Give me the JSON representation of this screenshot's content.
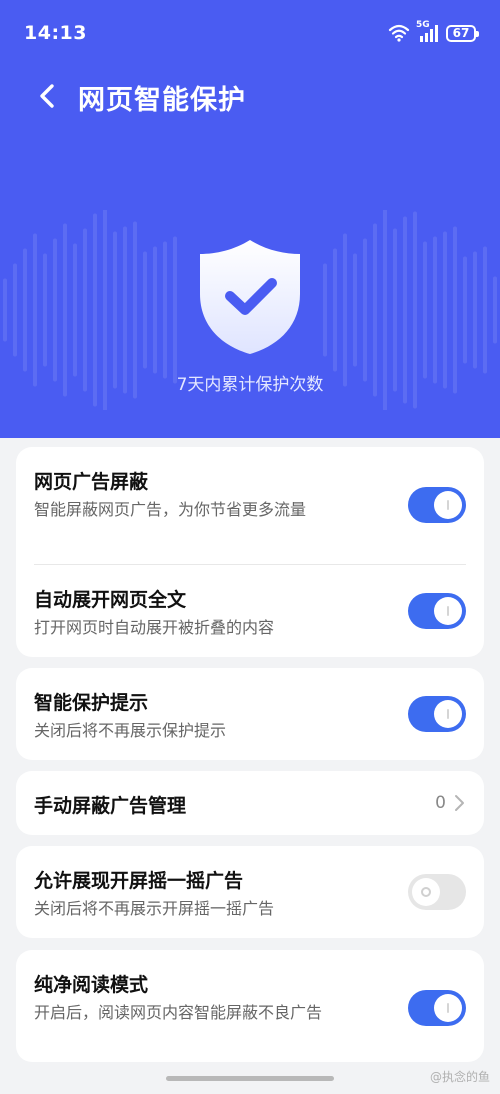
{
  "status": {
    "time": "14:13",
    "network": "5G",
    "battery": "67",
    "icons": [
      "wifi-icon",
      "signal-icon",
      "battery-icon"
    ]
  },
  "header": {
    "title": "网页智能保护",
    "back_icon": "chevron-left-icon"
  },
  "hero": {
    "shield_icon": "shield-check-icon",
    "caption": "7天内累计保护次数"
  },
  "settings": {
    "ad_block": {
      "title": "网页广告屏蔽",
      "desc": "智能屏蔽网页广告，为你节省更多流量",
      "enabled": true
    },
    "auto_expand": {
      "title": "自动展开网页全文",
      "desc": "打开网页时自动展开被折叠的内容",
      "enabled": true
    },
    "protect_tip": {
      "title": "智能保护提示",
      "desc": "关闭后将不再展示保护提示",
      "enabled": true
    },
    "manual_block": {
      "title": "手动屏蔽广告管理",
      "count": "0"
    },
    "shake_ads": {
      "title": "允许展现开屏摇一摇广告",
      "desc": "关闭后将不再展示开屏摇一摇广告",
      "enabled": false
    },
    "pure_read": {
      "title": "纯净阅读模式",
      "desc": "开启后，阅读网页内容智能屏蔽不良广告",
      "enabled": true
    }
  },
  "watermark": "@执念的鱼",
  "colors": {
    "hero_bg": "#4a5cf2",
    "toggle_on": "#3d6cf0",
    "toggle_off": "#e6e6e6",
    "page_bg": "#f2f3f5"
  }
}
